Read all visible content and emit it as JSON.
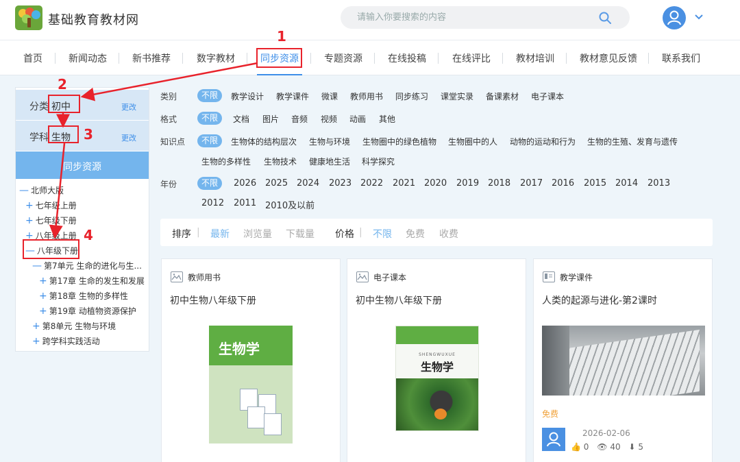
{
  "header": {
    "site_title": "基础教育教材网",
    "search_placeholder": "请输入你要搜索的内容",
    "logo_icon": "tree-logo-icon",
    "search_icon": "search-icon",
    "avatar_icon": "user-avatar-icon",
    "menu_icon": "chevron-down-icon"
  },
  "nav": {
    "items": [
      "首页",
      "新闻动态",
      "新书推荐",
      "数字教材",
      "同步资源",
      "专题资源",
      "在线投稿",
      "在线评比",
      "教材培训",
      "教材意见反馈",
      "联系我们"
    ],
    "active_index": 4
  },
  "sidebar": {
    "category_label": "分类",
    "category_value": "初中",
    "category_change": "更改",
    "subject_label": "学科",
    "subject_value": "生物",
    "subject_change": "更改",
    "section_title": "同步资源",
    "tree": [
      {
        "sym": "—",
        "label": "北师大版"
      },
      {
        "sym": "+",
        "label": "七年级上册"
      },
      {
        "sym": "+",
        "label": "七年级下册"
      },
      {
        "sym": "+",
        "label": "八年级上册"
      },
      {
        "sym": "—",
        "label": "八年级下册"
      },
      {
        "sym": "—",
        "label": "第7单元 生命的进化与生..."
      },
      {
        "sym": "+",
        "label": "第17章 生命的发生和发展"
      },
      {
        "sym": "+",
        "label": "第18章 生物的多样性"
      },
      {
        "sym": "+",
        "label": "第19章 动植物资源保护"
      },
      {
        "sym": "+",
        "label": "第8单元 生物与环境"
      },
      {
        "sym": "+",
        "label": "跨学科实践活动"
      }
    ]
  },
  "filters": {
    "type_label": "类别",
    "type_options": [
      "不限",
      "教学设计",
      "教学课件",
      "微课",
      "教师用书",
      "同步练习",
      "课堂实录",
      "备课素材",
      "电子课本"
    ],
    "format_label": "格式",
    "format_options": [
      "不限",
      "文档",
      "图片",
      "音频",
      "视频",
      "动画",
      "其他"
    ],
    "knowledge_label": "知识点",
    "knowledge_options": [
      "不限",
      "生物体的结构层次",
      "生物与环境",
      "生物圈中的绿色植物",
      "生物圈中的人",
      "动物的运动和行为",
      "生物的生殖、发育与遗传",
      "生物的多样性",
      "生物技术",
      "健康地生活",
      "科学探究"
    ],
    "year_label": "年份",
    "year_options": [
      "不限",
      "2026",
      "2025",
      "2024",
      "2023",
      "2022",
      "2021",
      "2020",
      "2019",
      "2018",
      "2017",
      "2016",
      "2015",
      "2014",
      "2013",
      "2012",
      "2011",
      "2010及以前"
    ]
  },
  "sort": {
    "sort_label": "排序",
    "sort_options": [
      "最新",
      "浏览量",
      "下载量"
    ],
    "price_label": "价格",
    "price_options": [
      "不限",
      "免费",
      "收费"
    ],
    "sep": "|"
  },
  "cards": [
    {
      "type": "教师用书",
      "title": "初中生物八年级下册",
      "icon": "image-icon",
      "cover_title": "生物学"
    },
    {
      "type": "电子课本",
      "title": "初中生物八年级下册",
      "icon": "image-icon",
      "cover_title": "生物学",
      "cover_pinyin": "SHENGWUXUE"
    },
    {
      "type": "教学课件",
      "title": "人类的起源与进化-第2课时",
      "icon": "slides-icon",
      "price": "免费",
      "date": "2026-02-06",
      "likes": "0",
      "views": "40",
      "downloads": "5"
    }
  ],
  "annotations": [
    "1",
    "2",
    "3",
    "4"
  ],
  "colors": {
    "accent": "#3d8ee8",
    "pill": "#74b5ed",
    "annotation": "#e8222b",
    "free": "#f0a23a"
  }
}
